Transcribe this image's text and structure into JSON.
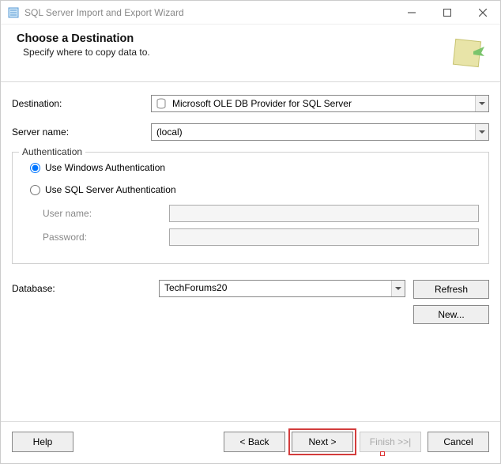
{
  "window": {
    "title": "SQL Server Import and Export Wizard"
  },
  "header": {
    "title": "Choose a Destination",
    "subtitle": "Specify where to copy data to."
  },
  "destination": {
    "label": "Destination:",
    "value": "Microsoft OLE DB Provider for SQL Server"
  },
  "server": {
    "label": "Server name:",
    "value": "(local)"
  },
  "auth": {
    "legend": "Authentication",
    "use_windows": "Use Windows Authentication",
    "use_sql": "Use SQL Server Authentication",
    "user_label": "User name:",
    "user_value": "",
    "pass_label": "Password:",
    "pass_value": ""
  },
  "database": {
    "label": "Database:",
    "value": "TechForums20",
    "refresh": "Refresh",
    "new": "New..."
  },
  "footer": {
    "help": "Help",
    "back": "< Back",
    "next": "Next >",
    "finish": "Finish >>|",
    "cancel": "Cancel"
  }
}
